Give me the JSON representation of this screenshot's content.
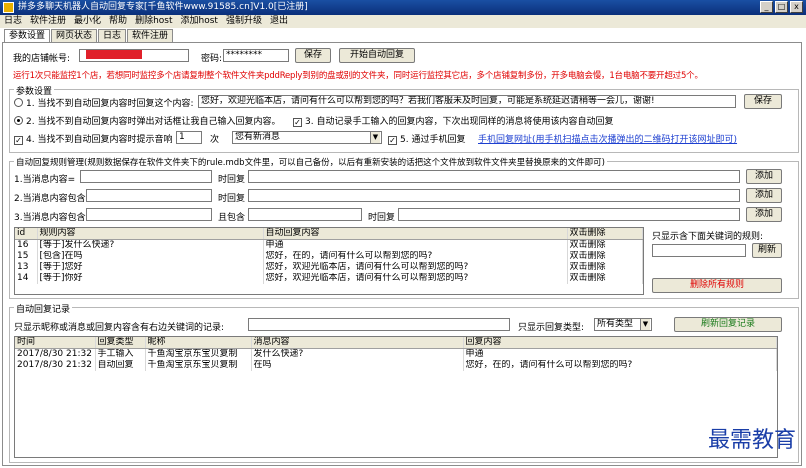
{
  "window": {
    "title": "拼多多聊天机器人自动回复专家[千鱼软件www.91585.cn]V1.0[已注册]",
    "min": "_",
    "max": "□",
    "close": "x"
  },
  "menu": [
    "日志",
    "软件注册",
    "最小化",
    "帮助",
    "删除host",
    "添加host",
    "强制升级",
    "退出"
  ],
  "tabs": [
    "参数设置",
    "网页状态",
    "日志",
    "软件注册"
  ],
  "store": {
    "label": "我的店铺帐号:",
    "value": "",
    "password_label": "密码:",
    "password_value": "********",
    "save": "保存",
    "start": "开始自动回复"
  },
  "notice": "运行1次只能监控1个店，若想同时监控多个店请复制整个软件文件夹pddReply到别的盘或别的文件夹，同时运行监控其它店，多个店铺复制多份，开多电脑会慢，1台电脑不要开超过5个。",
  "params": {
    "group_label": "参数设置",
    "opt1": "1. 当找不到自动回复内容时回复这个内容:",
    "opt1_value": "您好，欢迎光临本店，请问有什么可以帮到您的吗？若我们客服未及时回复，可能是系统延迟请稍等一会儿，谢谢!",
    "opt1_save": "保存",
    "opt2": "2. 当找不到自动回复内容时弹出对话框让我自己输入回复内容。",
    "opt3": "3. 自动记录手工输入的回复内容，下次出现同样的消息将使用该内容自动回复",
    "opt4": "4. 当找不到自动回复内容时提示音响",
    "opt4_times": "1",
    "opt4_unit": "次",
    "opt4_sound": "您有新消息",
    "opt5": "5. 通过手机回复",
    "opt5_link": "手机回复网址(用手机扫描点击次播弹出的二维码打开该网址即可)"
  },
  "rules": {
    "group_label": "自动回复规则管理(规则数据保存在软件文件夹下的rule.mdb文件里，可以自己备份，以后有重新安装的话把这个文件放到软件文件夹里替换原来的文件即可)",
    "row1_label": "1.当消息内容=",
    "row1_time": "时回复",
    "row2_label": "2.当消息内容包含",
    "row2_time": "时回复",
    "row3_label": "3.当消息内容包含",
    "row3_and": "且包含",
    "row3_time": "时回复",
    "add": "添加",
    "columns": [
      "id",
      "规则内容",
      "自动回复内容",
      "双击删除"
    ],
    "rows": [
      {
        "id": "16",
        "rule": "[等于]发什么快递?",
        "reply": "申通",
        "action": "双击删除"
      },
      {
        "id": "15",
        "rule": "[包含]在吗",
        "reply": "您好，在的，请问有什么可以帮到您的吗?",
        "action": "双击删除"
      },
      {
        "id": "13",
        "rule": "[等于]您好",
        "reply": "您好，欢迎光临本店，请问有什么可以帮到您的吗?",
        "action": "双击删除"
      },
      {
        "id": "14",
        "rule": "[等于]你好",
        "reply": "您好，欢迎光临本店，请问有什么可以帮到您的吗?",
        "action": "双击删除"
      }
    ],
    "filter_label": "只显示含下面关键词的规则:",
    "refresh": "刷新",
    "delete_all": "删除所有规则"
  },
  "records": {
    "group_label": "自动回复记录",
    "filter_label": "只显示昵称或消息或回复内容含有右边关键词的记录:",
    "type_label": "只显示回复类型:",
    "type_value": "所有类型",
    "refresh": "刷新回复记录",
    "columns": [
      "时间",
      "回复类型",
      "昵称",
      "消息内容",
      "回复内容"
    ],
    "rows": [
      {
        "time": "2017/8/30 21:32",
        "type": "手工输入",
        "nick": "千鱼淘宝京东宝贝复制",
        "msg": "发什么快递?",
        "reply": "申通"
      },
      {
        "time": "2017/8/30 21:32",
        "type": "自动回复",
        "nick": "千鱼淘宝京东宝贝复制",
        "msg": "在吗",
        "reply": "您好，在的，请问有什么可以帮到您的吗?"
      }
    ]
  },
  "watermark": "最需教育",
  "colors": {
    "title_bar": "#0a2f7a",
    "warning_text": "#e00000",
    "link": "#1d3fd0",
    "delete_text": "#e00000"
  }
}
